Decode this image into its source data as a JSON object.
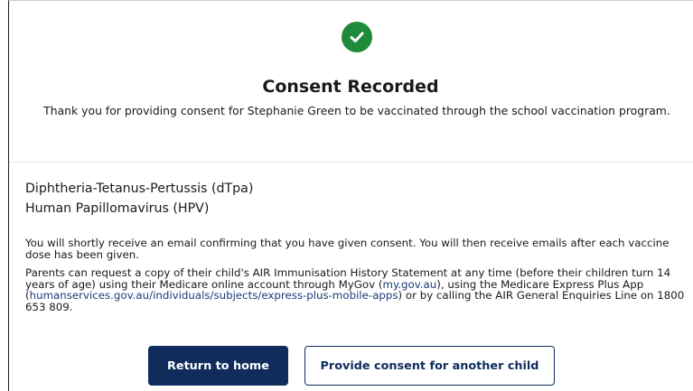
{
  "header": {
    "title": "Consent Recorded",
    "message": "Thank you for providing consent for Stephanie Green to be vaccinated through the school vaccination program."
  },
  "vaccines": [
    "Diphtheria-Tetanus-Pertussis (dTpa)",
    "Human Papillomavirus (HPV)"
  ],
  "info": {
    "email_notice": "You will shortly receive an email confirming that you have given consent. You will then receive emails after each vaccine dose has been given.",
    "history_part1": "Parents can request a copy of their child's AIR Immunisation History Statement at any time (before their children turn 14 years of age) using their Medicare online account through MyGov (",
    "mygov_link": "my.gov.au",
    "history_part2": "), using the Medicare Express Plus App (",
    "express_link": "humanservices.gov.au/individuals/subjects/express-plus-mobile-apps",
    "history_part3": ") or by calling the AIR General Enquiries Line on 1800 653 809."
  },
  "actions": {
    "return_home": "Return to home",
    "another_child": "Provide consent for another child"
  },
  "colors": {
    "success": "#1f8a3a",
    "primary": "#0f2c5c",
    "link": "#1a3a7a"
  },
  "icons": {
    "success": "check-circle-icon"
  }
}
